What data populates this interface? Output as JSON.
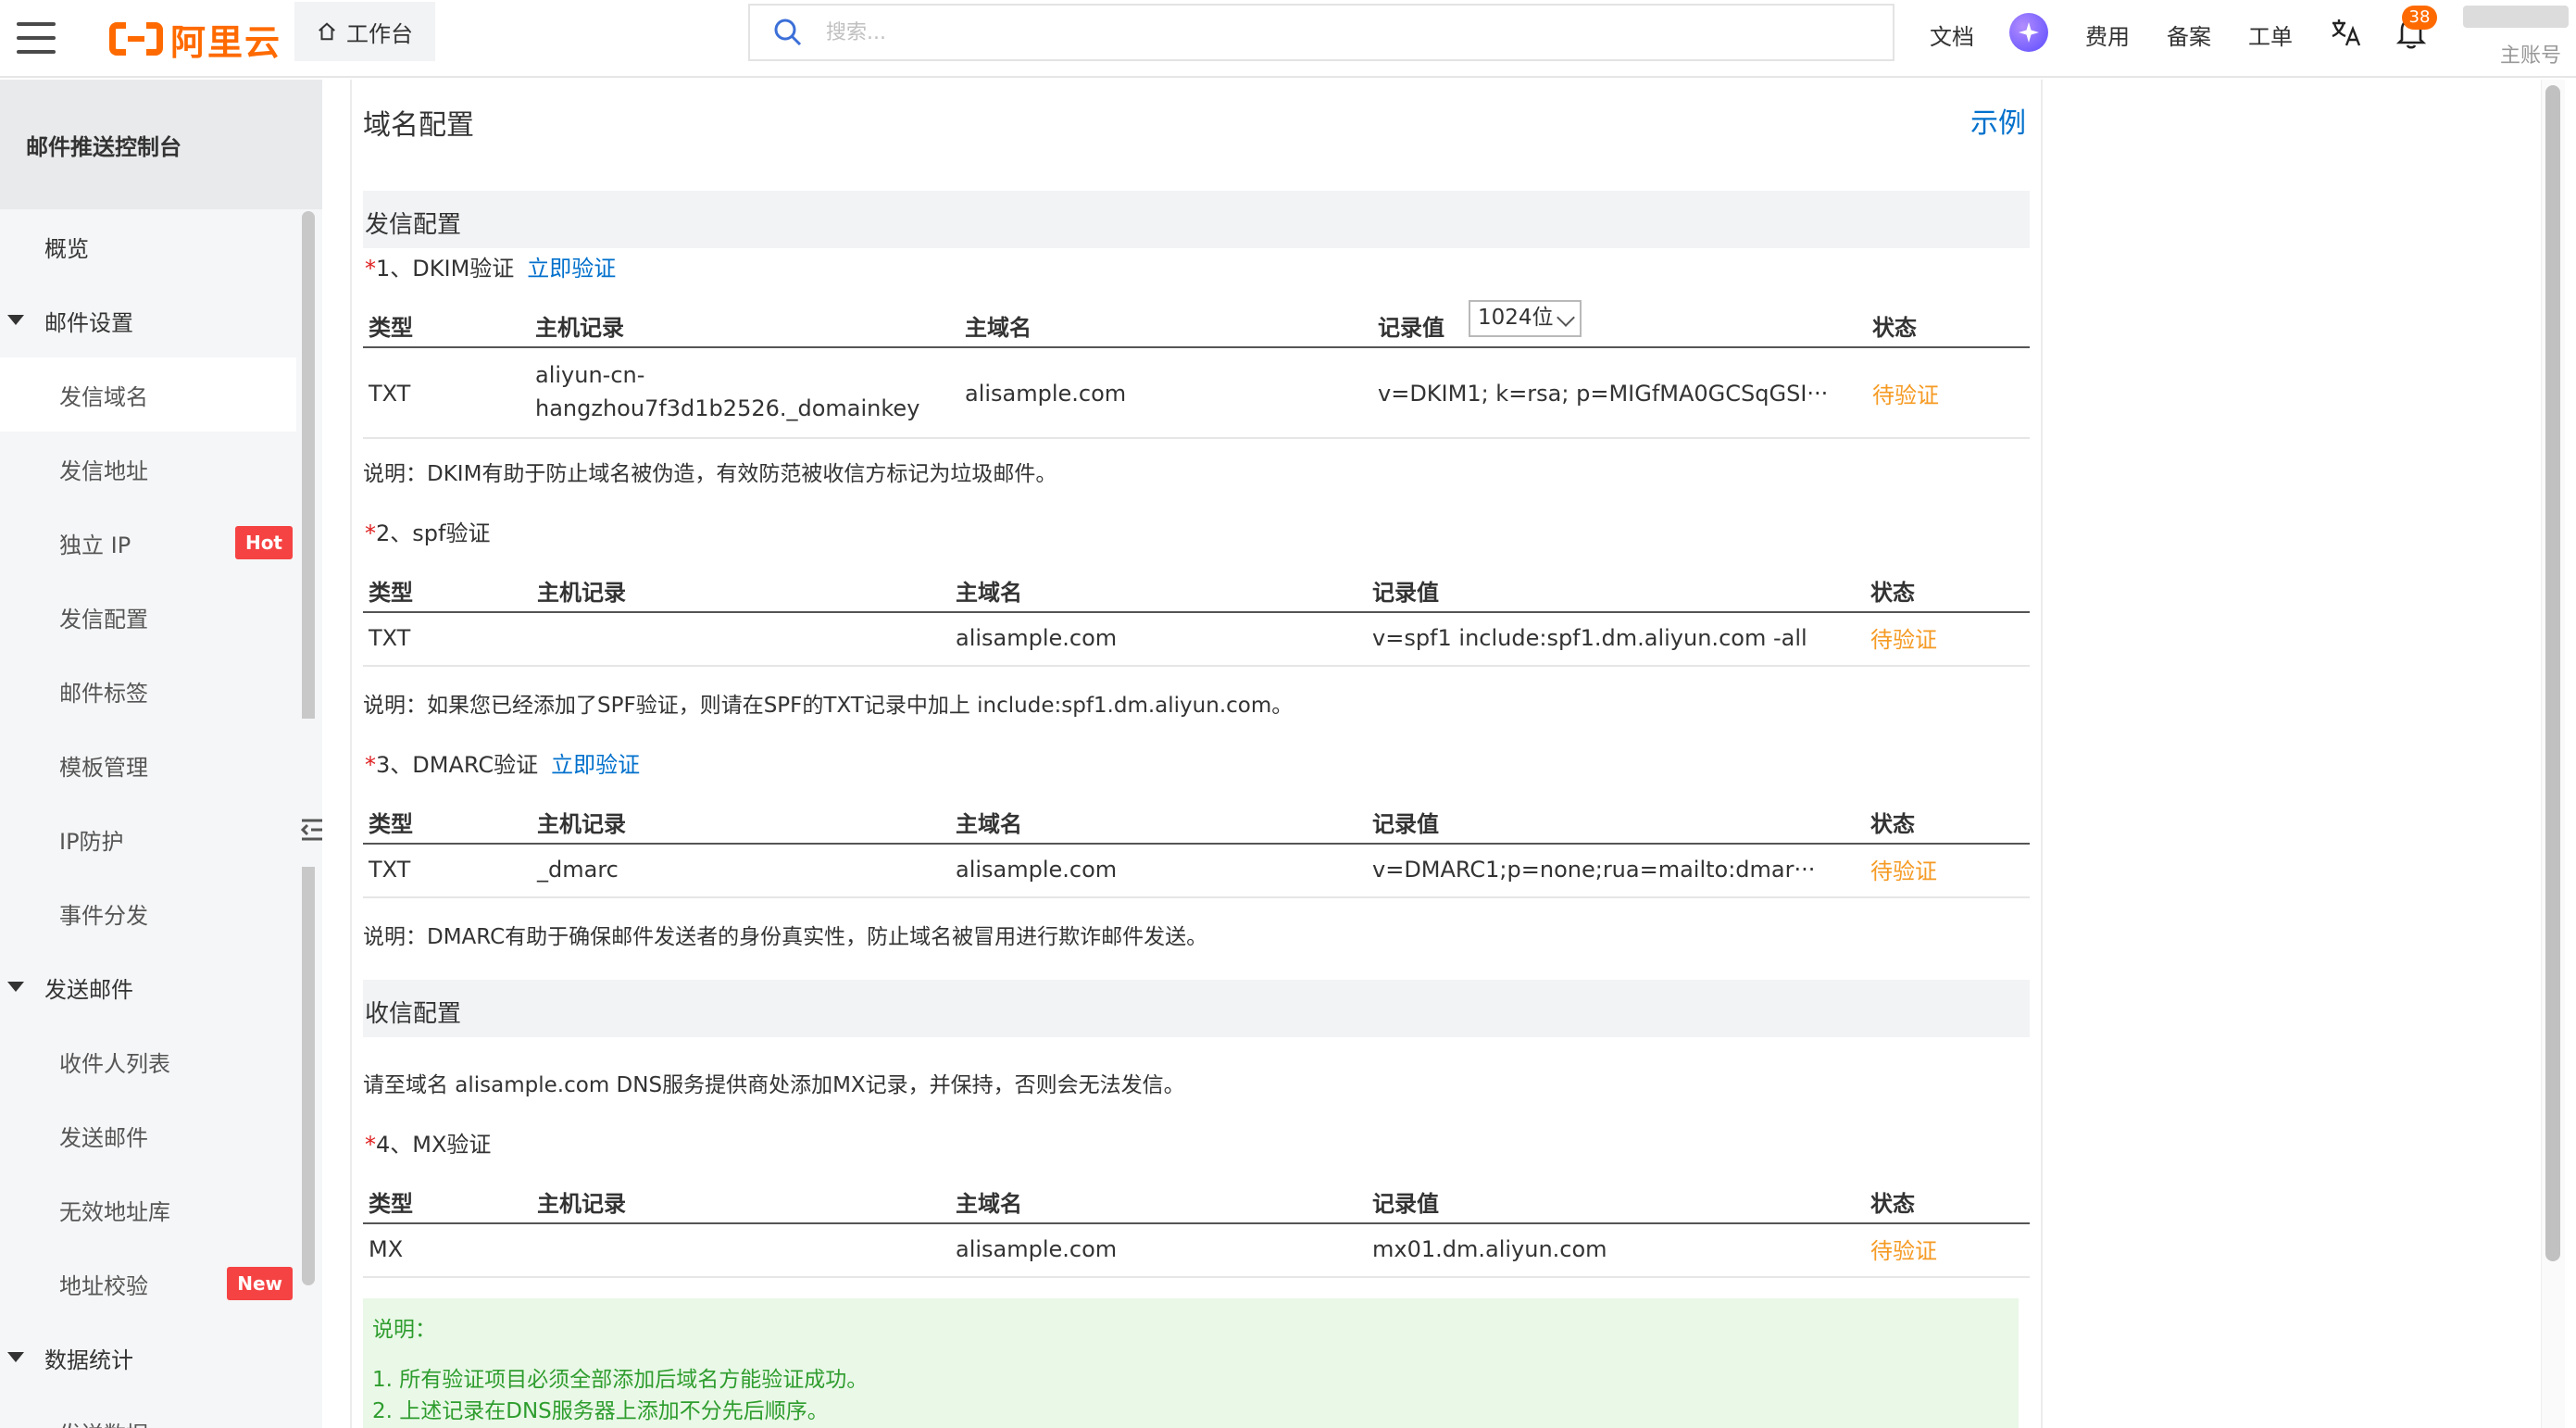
{
  "topbar": {
    "logo_text": "阿里云",
    "workbench_label": "工作台",
    "search_placeholder": "搜索...",
    "docs_label": "文档",
    "billing_label": "费用",
    "icp_label": "备案",
    "ticket_label": "工单",
    "notification_count": "38",
    "account_label": "主账号",
    "accent_color": "#ff6a00"
  },
  "sidebar": {
    "title": "邮件推送控制台",
    "items": [
      {
        "label": "概览",
        "kind": "top"
      },
      {
        "label": "邮件设置",
        "kind": "group"
      },
      {
        "label": "发信域名",
        "kind": "sub",
        "active": true
      },
      {
        "label": "发信地址",
        "kind": "sub"
      },
      {
        "label": "独立 IP",
        "kind": "sub",
        "tag": "Hot"
      },
      {
        "label": "发信配置",
        "kind": "sub"
      },
      {
        "label": "邮件标签",
        "kind": "sub"
      },
      {
        "label": "模板管理",
        "kind": "sub"
      },
      {
        "label": "IP防护",
        "kind": "sub"
      },
      {
        "label": "事件分发",
        "kind": "sub"
      },
      {
        "label": "发送邮件",
        "kind": "group"
      },
      {
        "label": "收件人列表",
        "kind": "sub"
      },
      {
        "label": "发送邮件",
        "kind": "sub"
      },
      {
        "label": "无效地址库",
        "kind": "sub"
      },
      {
        "label": "地址校验",
        "kind": "sub",
        "tag": "New"
      },
      {
        "label": "数据统计",
        "kind": "group"
      },
      {
        "label": "发送数据",
        "kind": "sub"
      }
    ]
  },
  "main": {
    "title": "域名配置",
    "example_link": "示例",
    "send_section": "发信配置",
    "receive_section": "收信配置",
    "required_mark": "*",
    "verify_now": "立即验证",
    "headers": {
      "type": "类型",
      "host": "主机记录",
      "domain": "主域名",
      "value": "记录值",
      "status": "状态"
    },
    "dkim": {
      "label": "1、DKIM验证",
      "select_value": "1024位",
      "type": "TXT",
      "host_line1": "aliyun-cn-",
      "host_line2": "hangzhou7f3d1b2526._domainkey",
      "domain": "alisample.com",
      "value": "v=DKIM1; k=rsa; p=MIGfMA0GCSqGSI···",
      "status": "待验证",
      "note": "说明：DKIM有助于防止域名被伪造，有效防范被收信方标记为垃圾邮件。"
    },
    "spf": {
      "label": "2、spf验证",
      "type": "TXT",
      "host": "",
      "domain": "alisample.com",
      "value": "v=spf1 include:spf1.dm.aliyun.com -all",
      "status": "待验证",
      "note": "说明：如果您已经添加了SPF验证，则请在SPF的TXT记录中加上 include:spf1.dm.aliyun.com。"
    },
    "dmarc": {
      "label": "3、DMARC验证",
      "type": "TXT",
      "host": "_dmarc",
      "domain": "alisample.com",
      "value": "v=DMARC1;p=none;rua=mailto:dmar···",
      "status": "待验证",
      "note": "说明：DMARC有助于确保邮件发送者的身份真实性，防止域名被冒用进行欺诈邮件发送。"
    },
    "receive_note": "请至域名 alisample.com DNS服务提供商处添加MX记录，并保持，否则会无法发信。",
    "mx": {
      "label": "4、MX验证",
      "type": "MX",
      "host": "",
      "domain": "alisample.com",
      "value": "mx01.dm.aliyun.com",
      "status": "待验证"
    },
    "tips": {
      "title": "说明：",
      "line1": "1. 所有验证项目必须全部添加后域名方能验证成功。",
      "line2": "2. 上述记录在DNS服务器上添加不分先后顺序。"
    }
  }
}
